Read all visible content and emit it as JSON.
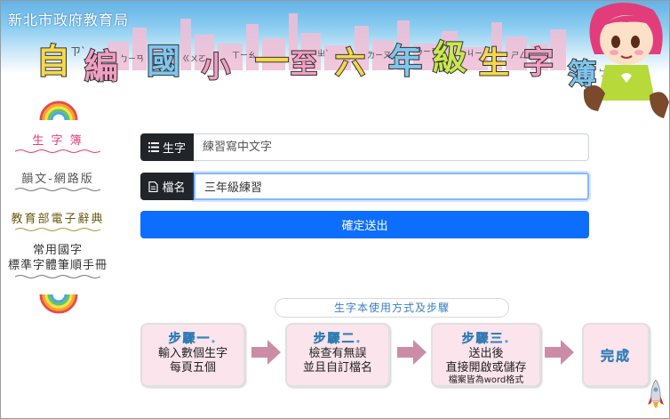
{
  "header": {
    "agency": "新北市政府教育局",
    "title_chars": [
      "自",
      "編",
      "國",
      "小",
      "一",
      "至",
      "六",
      "年",
      "級",
      "生",
      "字",
      "簿"
    ],
    "title_ruby": [
      "ㄗ`",
      "ㄅㄧㄢ",
      "ㄍㄨㄛ",
      "ㄒㄧㄠ",
      "ㄧ",
      "ㄓ`",
      "ㄌㄧㄡ",
      "ㄋㄧㄢ",
      "ㄐㄧ",
      "ㄕㄥ",
      "ㄗ`",
      "ㄅㄨ"
    ]
  },
  "sidebar": {
    "items": [
      {
        "label": "生 字 簿"
      },
      {
        "label": "韻文-網路版"
      },
      {
        "label": "教育部電子辭典"
      },
      {
        "label_line1": "常用國字",
        "label_line2": "標準字體筆順手冊"
      }
    ]
  },
  "form": {
    "field1": {
      "label": "生字",
      "icon": "list-icon",
      "placeholder": "練習寫中文字"
    },
    "field2": {
      "label": "檔名",
      "icon": "file-icon",
      "value": "三年級練習"
    },
    "submit_label": "確定送出"
  },
  "steps": {
    "title": "生字本使用方式及步驟",
    "items": [
      {
        "head": "步驟一.",
        "line1": "輸入數個生字",
        "line2": "每頁五個"
      },
      {
        "head": "步驟二.",
        "line1": "檢查有無誤",
        "line2": "並且自訂檔名"
      },
      {
        "head": "步驟三.",
        "line1": "送出後",
        "line2": "直接開啟或儲存",
        "note": "檔案皆為word格式"
      },
      {
        "head": "完成"
      }
    ]
  },
  "colors": {
    "accent": "#0d6efd",
    "label_bg": "#212529",
    "step_bg": "#fbe4ec",
    "arrow": "#cc8ca6",
    "step_head": "#5aaee0"
  }
}
